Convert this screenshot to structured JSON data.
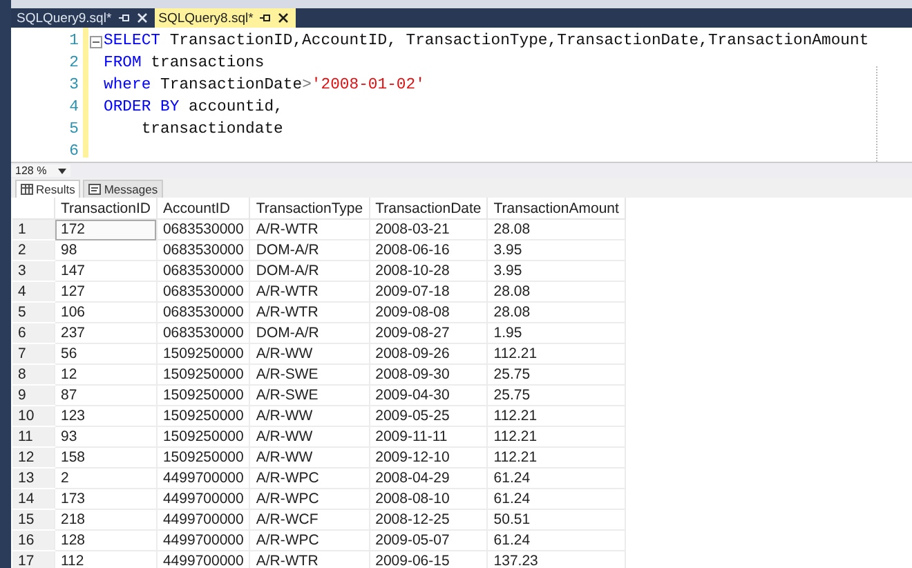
{
  "editor_tabs": [
    {
      "label": "SQLQuery9.sql*",
      "selected": false
    },
    {
      "label": "SQLQuery8.sql*",
      "selected": true
    }
  ],
  "code_lines": [
    {
      "number": "1",
      "fold": true,
      "tokens": [
        {
          "kind": "keyword",
          "text": "SELECT"
        },
        {
          "kind": "plain",
          "text": " TransactionID,AccountID, TransactionType,TransactionDate,TransactionAmount"
        }
      ]
    },
    {
      "number": "2",
      "fold": false,
      "tokens": [
        {
          "kind": "keyword",
          "text": "FROM"
        },
        {
          "kind": "plain",
          "text": " transactions"
        }
      ]
    },
    {
      "number": "3",
      "fold": false,
      "tokens": [
        {
          "kind": "keyword",
          "text": "where"
        },
        {
          "kind": "plain",
          "text": " TransactionDate"
        },
        {
          "kind": "operator",
          "text": ">"
        },
        {
          "kind": "string",
          "text": "'2008-01-02'"
        }
      ]
    },
    {
      "number": "4",
      "fold": false,
      "tokens": [
        {
          "kind": "keyword",
          "text": "ORDER BY"
        },
        {
          "kind": "plain",
          "text": " accountid,"
        }
      ]
    },
    {
      "number": "5",
      "fold": false,
      "tokens": [
        {
          "kind": "plain",
          "text": "    transactiondate"
        }
      ]
    },
    {
      "number": "6",
      "fold": false
    }
  ],
  "zoom": "128 %",
  "result_tabs": [
    {
      "label": "Results",
      "selected": true
    },
    {
      "label": "Messages",
      "selected": false
    }
  ],
  "grid": {
    "columns": [
      "TransactionID",
      "AccountID",
      "TransactionType",
      "TransactionDate",
      "TransactionAmount"
    ],
    "rows": [
      {
        "number": "1",
        "selected": true,
        "cells": [
          "172",
          "0683530000",
          "A/R-WTR",
          "2008-03-21",
          "28.08"
        ]
      },
      {
        "number": "2",
        "selected": false,
        "cells": [
          "98",
          "0683530000",
          "DOM-A/R",
          "2008-06-16",
          "3.95"
        ]
      },
      {
        "number": "3",
        "selected": false,
        "cells": [
          "147",
          "0683530000",
          "DOM-A/R",
          "2008-10-28",
          "3.95"
        ]
      },
      {
        "number": "4",
        "selected": false,
        "cells": [
          "127",
          "0683530000",
          "A/R-WTR",
          "2009-07-18",
          "28.08"
        ]
      },
      {
        "number": "5",
        "selected": false,
        "cells": [
          "106",
          "0683530000",
          "A/R-WTR",
          "2009-08-08",
          "28.08"
        ]
      },
      {
        "number": "6",
        "selected": false,
        "cells": [
          "237",
          "0683530000",
          "DOM-A/R",
          "2009-08-27",
          "1.95"
        ]
      },
      {
        "number": "7",
        "selected": false,
        "cells": [
          "56",
          "1509250000",
          "A/R-WW",
          "2008-09-26",
          "112.21"
        ]
      },
      {
        "number": "8",
        "selected": false,
        "cells": [
          "12",
          "1509250000",
          "A/R-SWE",
          "2008-09-30",
          "25.75"
        ]
      },
      {
        "number": "9",
        "selected": false,
        "cells": [
          "87",
          "1509250000",
          "A/R-SWE",
          "2009-04-30",
          "25.75"
        ]
      },
      {
        "number": "10",
        "selected": false,
        "cells": [
          "123",
          "1509250000",
          "A/R-WW",
          "2009-05-25",
          "112.21"
        ]
      },
      {
        "number": "11",
        "selected": false,
        "cells": [
          "93",
          "1509250000",
          "A/R-WW",
          "2009-11-11",
          "112.21"
        ]
      },
      {
        "number": "12",
        "selected": false,
        "cells": [
          "158",
          "1509250000",
          "A/R-WW",
          "2009-12-10",
          "112.21"
        ]
      },
      {
        "number": "13",
        "selected": false,
        "cells": [
          "2",
          "4499700000",
          "A/R-WPC",
          "2008-04-29",
          "61.24"
        ]
      },
      {
        "number": "14",
        "selected": false,
        "cells": [
          "173",
          "4499700000",
          "A/R-WPC",
          "2008-08-10",
          "61.24"
        ]
      },
      {
        "number": "15",
        "selected": false,
        "cells": [
          "218",
          "4499700000",
          "A/R-WCF",
          "2008-12-25",
          "50.51"
        ]
      },
      {
        "number": "16",
        "selected": false,
        "cells": [
          "128",
          "4499700000",
          "A/R-WPC",
          "2009-05-07",
          "61.24"
        ]
      },
      {
        "number": "17",
        "selected": false,
        "cells": [
          "112",
          "4499700000",
          "A/R-WTR",
          "2009-06-15",
          "137.23"
        ]
      }
    ]
  }
}
